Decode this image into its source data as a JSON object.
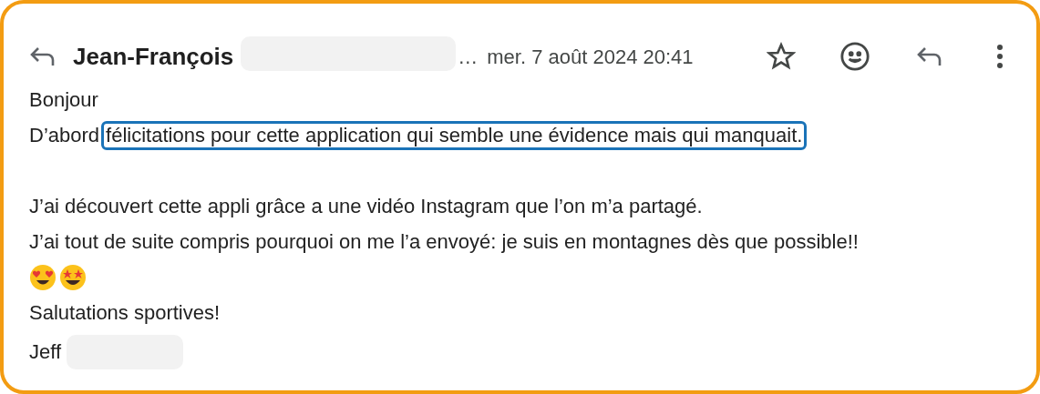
{
  "header": {
    "sender": "Jean-François",
    "sender_redacted": true,
    "ellipsis": "…",
    "date": "mer. 7 août 2024 20:41"
  },
  "body": [
    {
      "kind": "text",
      "text": "Bonjour"
    },
    {
      "kind": "highlight",
      "lead": "D’abord",
      "marked": "félicitations pour cette application qui semble une évidence mais qui manquait."
    },
    {
      "kind": "gap"
    },
    {
      "kind": "text",
      "text": "J’ai découvert cette appli grâce a une vidéo Instagram que l’on m’a partagé."
    },
    {
      "kind": "text",
      "text": "J’ai tout de suite compris pourquoi on me l’a envoyé: je suis en montagnes dès que possible!!"
    },
    {
      "kind": "emoji"
    },
    {
      "kind": "text",
      "text": "Salutations sportives!"
    },
    {
      "kind": "signature",
      "text": "Jeff",
      "redacted": true
    }
  ]
}
